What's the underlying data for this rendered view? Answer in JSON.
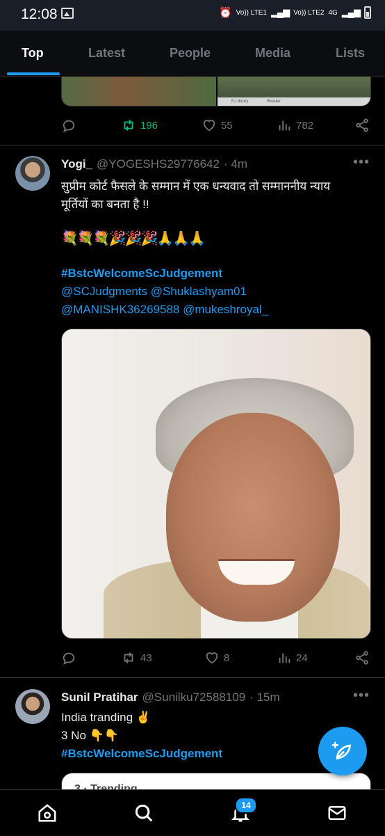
{
  "status_bar": {
    "time": "12:08",
    "network_1": "Vo)) LTE1",
    "network_2": "Vo)) LTE2",
    "data": "4G"
  },
  "tabs": [
    "Top",
    "Latest",
    "People",
    "Media",
    "Lists"
  ],
  "previous_tweet": {
    "retweets": "196",
    "likes": "55",
    "views": "782",
    "media_caption_1": "E-Library",
    "media_caption_2": "Reader"
  },
  "tweet1": {
    "name": "Yogi_",
    "handle": "@YOGESHS29776642",
    "time": "· 4m",
    "text_line1": "सुप्रीम कोर्ट फैसले के सम्मान में एक धन्यवाद तो सम्माननीय न्याय",
    "text_line2": "मूर्तियों का बनता है !!",
    "emoji_line": "💐💐💐🎉🎉🎉🙏🙏🙏",
    "hashtag": "#BstcWelcomeScJudgement",
    "mentions_line1": "@SCJudgments  @Shuklashyam01",
    "mentions_line2": "@MANISHK36269588 @mukeshroyal_",
    "replies": "",
    "retweets": "43",
    "likes": "8",
    "views": "24"
  },
  "tweet2": {
    "name": "Sunil Pratihar",
    "handle": "@Sunilku72588109",
    "time": "· 15m",
    "text_line1": "India tranding ✌️",
    "text_line2": "3 No 👇👇",
    "hashtag": "#BstcWelcomeScJudgement",
    "quote_preview": "3 · Trending"
  },
  "bottom_nav": {
    "notifications_badge": "14"
  },
  "colors": {
    "accent": "#1d9bf0",
    "retweet_green": "#00ba7c",
    "muted": "#71767b",
    "background": "#000000"
  },
  "icons": [
    "reply-icon",
    "retweet-icon",
    "like-icon",
    "views-icon",
    "share-icon",
    "more-icon",
    "compose-icon",
    "home-icon",
    "search-icon",
    "notifications-icon",
    "messages-icon"
  ]
}
